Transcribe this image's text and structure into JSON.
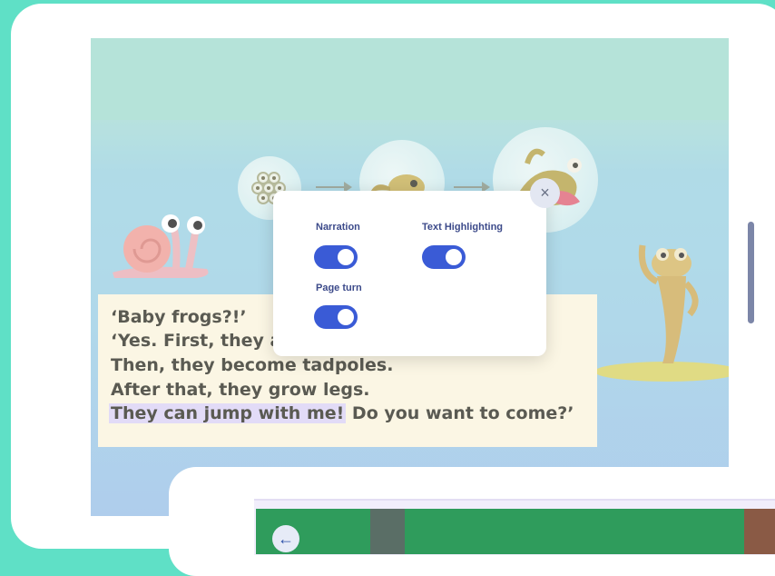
{
  "story": {
    "lines": [
      "‘Baby frogs?!’",
      "‘Yes. First, they a",
      "Then, they become tadpoles.",
      "After that, they grow legs.",
      "Do you want to come?’"
    ],
    "highlighted_text": "They can jump with me!"
  },
  "settings_modal": {
    "close_icon": "×",
    "narration_label": "Narration",
    "narration_on": true,
    "text_highlighting_label": "Text Highlighting",
    "text_highlighting_on": true,
    "page_turn_label": "Page turn",
    "page_turn_on": true
  },
  "second_card": {
    "back_icon": "←"
  },
  "colors": {
    "background": "#5fe0c6",
    "toggle_on": "#3a5bd6",
    "label_text": "#3c4a8a",
    "highlight": "#e2dbf7"
  }
}
